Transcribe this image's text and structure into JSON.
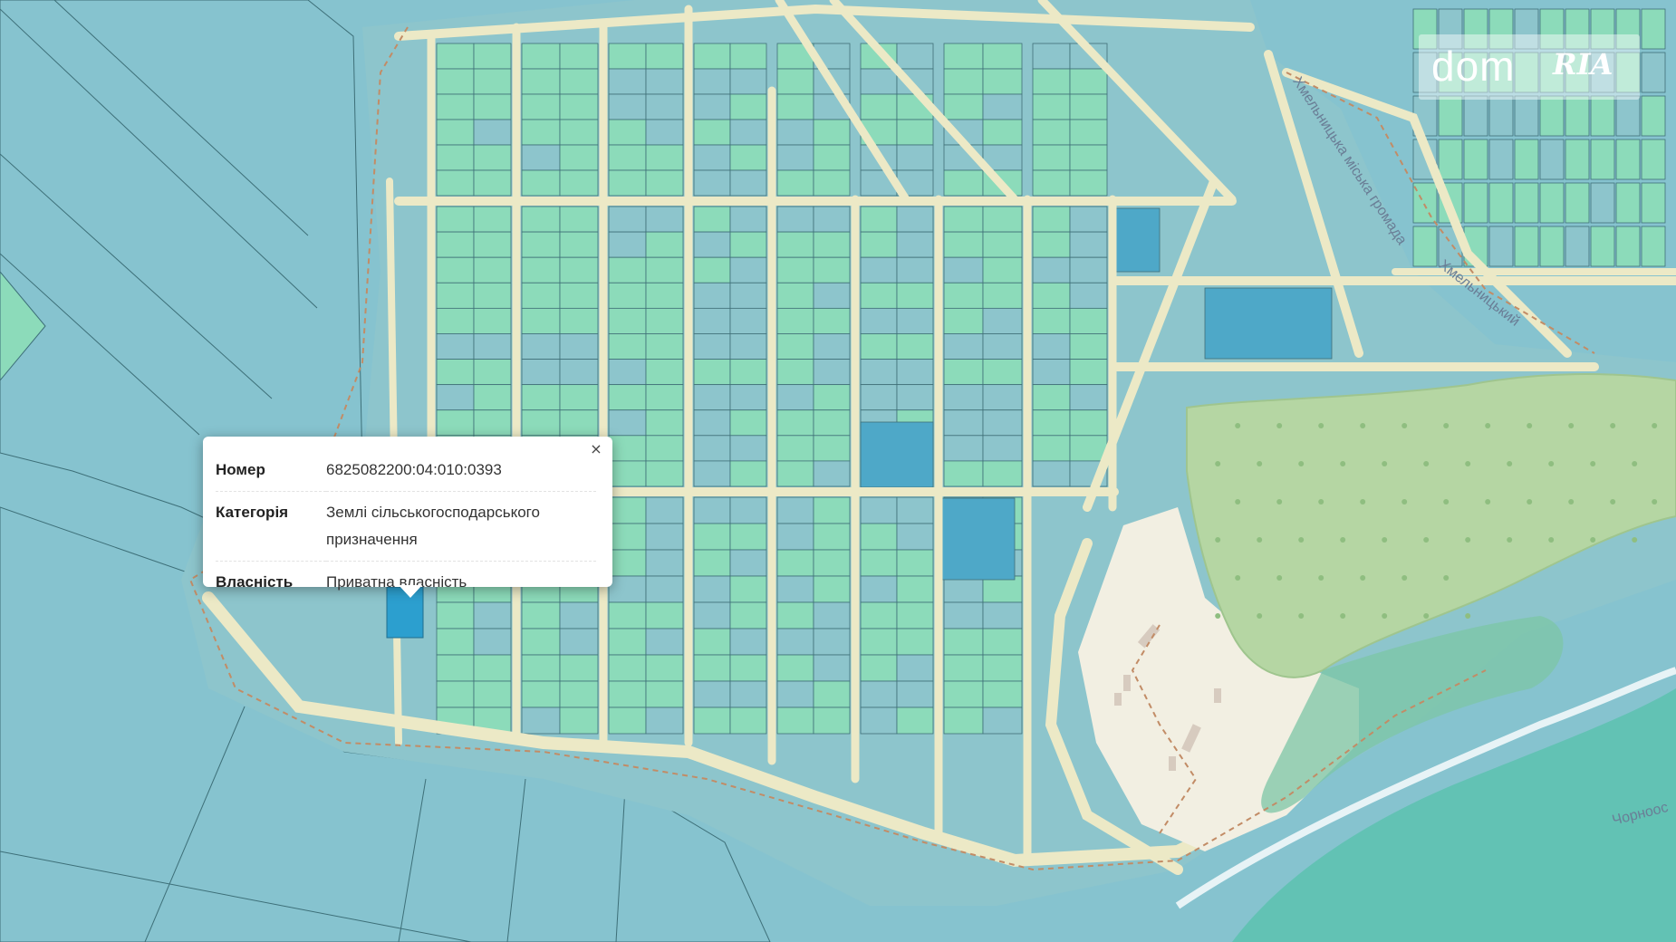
{
  "popup": {
    "rows": [
      {
        "key": "Номер",
        "value": "6825082200:04:010:0393"
      },
      {
        "key": "Категорія",
        "value": "Землі сільськогосподарського призначення"
      },
      {
        "key": "Власність",
        "value": "Приватна власність"
      }
    ],
    "close_label": "×"
  },
  "watermark": {
    "dom": "dom",
    "ria": "RIA"
  },
  "road_labels": [
    {
      "text": "Хмельницька міська громада"
    },
    {
      "text": "Хмельницький"
    },
    {
      "text": "Чорноос"
    }
  ],
  "colors": {
    "water_light": "#86c3cf",
    "water_dark": "#62c2b4",
    "parcel_green": "#8cdbba",
    "parcel_teal": "#8dc5cc",
    "parcel_highlight": "#4ea8c8",
    "selected_parcel": "#2c9fcf",
    "road": "#ece9c6",
    "forest": "#b5d6a3",
    "beach": "#f2efe2"
  }
}
